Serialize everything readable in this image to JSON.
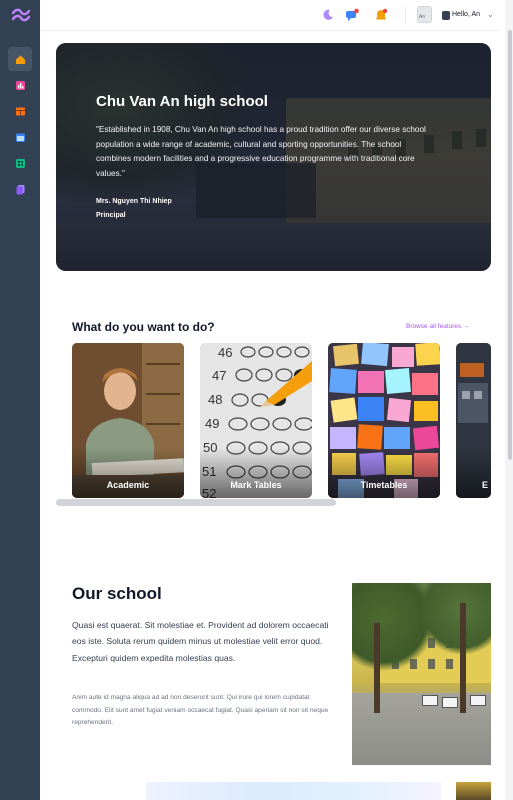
{
  "topbar": {
    "avatar_alt": "An",
    "greeting": "Hello, An",
    "icons": [
      "moon-icon",
      "chat-icon",
      "bell-icon"
    ]
  },
  "sidebar": {
    "items": [
      {
        "icon": "home-icon",
        "color": "#f59e0b",
        "active": true
      },
      {
        "icon": "chart-icon",
        "color": "#ec4899",
        "active": false
      },
      {
        "icon": "table-icon",
        "color": "#f97316",
        "active": false
      },
      {
        "icon": "calendar-icon",
        "color": "#3b82f6",
        "active": false
      },
      {
        "icon": "grid-icon",
        "color": "#10b981",
        "active": false
      },
      {
        "icon": "document-icon",
        "color": "#8b5cf6",
        "active": false
      }
    ]
  },
  "hero": {
    "title": "Chu Van An high school",
    "quote": "\"Established in 1908, Chu Van An high school has a proud tradition offer our diverse school population a wide range of academic, cultural and sporting opportunities. The school combines modern facilities and a progressive education programme with traditional core values.\"",
    "author": "Mrs. Nguyen Thi Nhiep",
    "role": "Principal"
  },
  "features": {
    "title": "What do you want to do?",
    "browse_all": "Browse all features →",
    "cards": [
      {
        "label": "Academic"
      },
      {
        "label": "Mark Tables"
      },
      {
        "label": "Timetables"
      },
      {
        "label": "E"
      }
    ]
  },
  "school": {
    "title": "Our school",
    "intro": "Quasi est quaerat. Sit molestiae et. Provident ad dolorem occaecati eos iste. Soluta rerum quidem minus ut molestiae velit error quod. Excepturi quidem expedita molestias quas.",
    "body": "Anim aute id magna aliqua ad ad non deserunt sunt. Qui irure qui lorem cupidatat commodo. Elit sunt amet fugiat veniam occaecat fugiat. Quasi aperiam sit non sit neque reprehenderit."
  },
  "colors": {
    "sidebar_bg": "#334155",
    "accent": "#a855f7"
  }
}
